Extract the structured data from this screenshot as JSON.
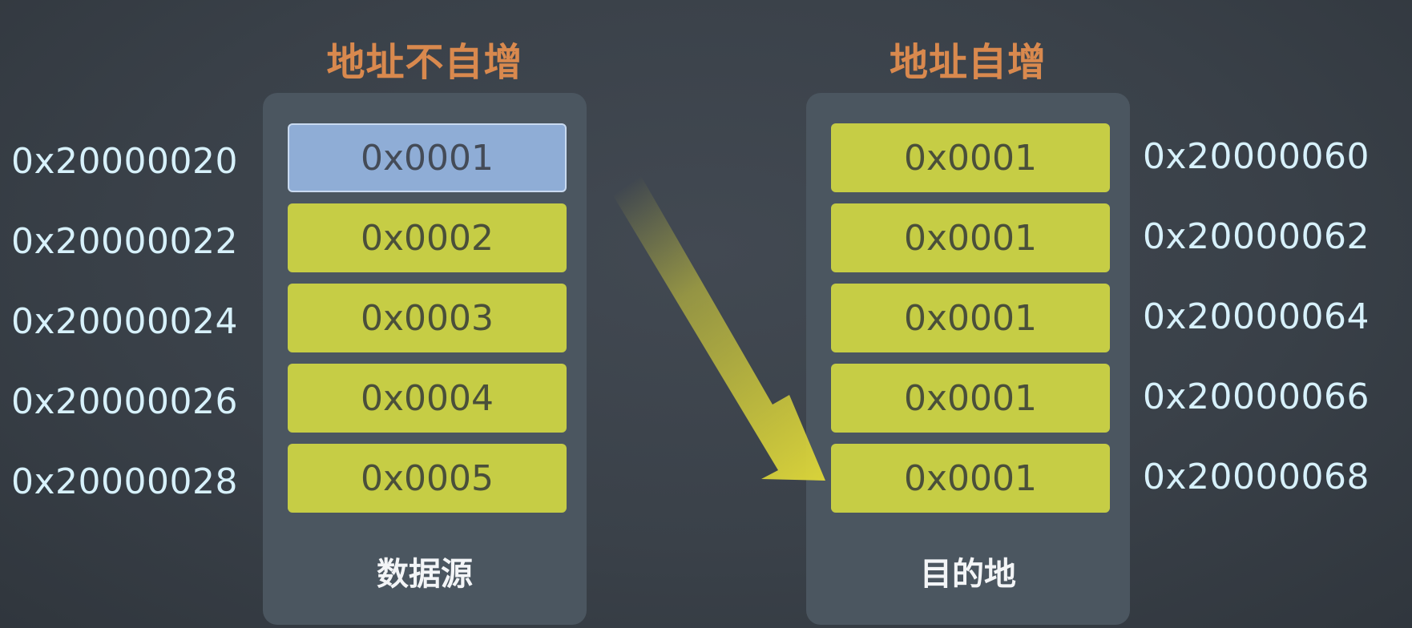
{
  "left": {
    "title": "地址不自增",
    "label": "数据源",
    "cells": [
      "0x0001",
      "0x0002",
      "0x0003",
      "0x0004",
      "0x0005"
    ],
    "addresses": [
      "0x20000020",
      "0x20000022",
      "0x20000024",
      "0x20000026",
      "0x20000028"
    ],
    "highlight_index": 0
  },
  "right": {
    "title": "地址自增",
    "label": "目的地",
    "cells": [
      "0x0001",
      "0x0001",
      "0x0001",
      "0x0001",
      "0x0001"
    ],
    "addresses": [
      "0x20000060",
      "0x20000062",
      "0x20000064",
      "0x20000066",
      "0x20000068"
    ]
  },
  "colors": {
    "background": "#3a4149",
    "panel": "#4b5660",
    "cell_yellow": "#c6cd45",
    "cell_highlight": "#8fadd6",
    "title": "#d9894e",
    "address_text": "#d7f1fb",
    "arrow": "#d8d23a"
  }
}
